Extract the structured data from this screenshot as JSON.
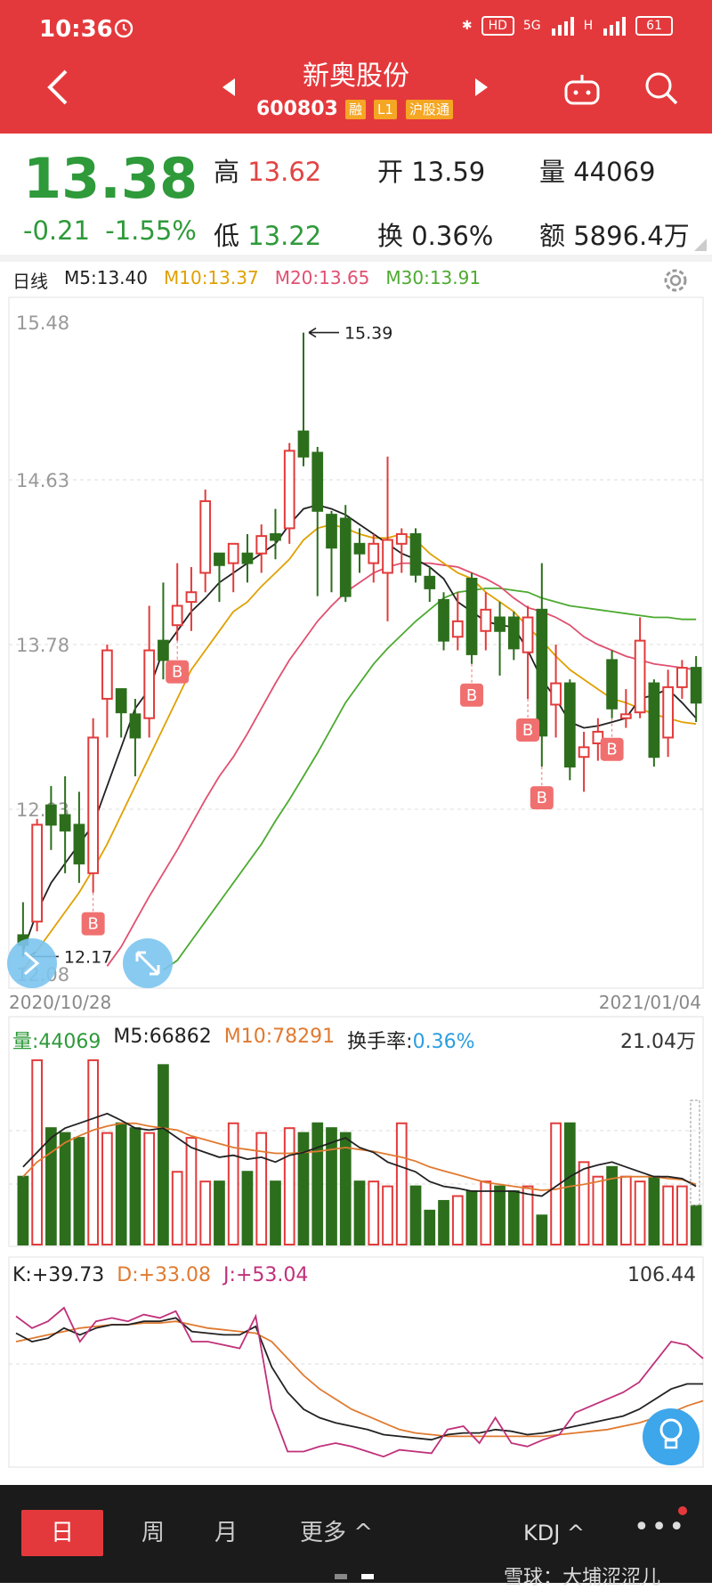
{
  "status": {
    "time": "10:36",
    "battery": "61",
    "hd": "HD",
    "net": "5G",
    "h": "H"
  },
  "header": {
    "name": "新奥股份",
    "code": "600803",
    "tags": [
      "融",
      "L1",
      "沪股通"
    ]
  },
  "quote": {
    "price": "13.38",
    "change": "-0.21",
    "change_pct": "-1.55%",
    "high_label": "高",
    "high": "13.62",
    "low_label": "低",
    "low": "13.22",
    "open_label": "开",
    "open": "13.59",
    "turn_label": "换",
    "turn": "0.36%",
    "vol_label": "量",
    "vol": "44069",
    "amt_label": "额",
    "amt": "5896.4万"
  },
  "chart": {
    "period": "日线",
    "ma": [
      {
        "label": "M5:13.40",
        "color": "#222222"
      },
      {
        "label": "M10:13.37",
        "color": "#e0a000"
      },
      {
        "label": "M20:13.65",
        "color": "#e05070"
      },
      {
        "label": "M30:13.91",
        "color": "#4caa30"
      }
    ],
    "y_ticks": [
      "15.48",
      "14.63",
      "13.78",
      "12.93",
      "12.08"
    ],
    "high_marker": "15.39",
    "low_marker": "12.17",
    "signal_label": "B",
    "start_date": "2020/10/28",
    "end_date": "2021/01/04"
  },
  "volume": {
    "items": [
      {
        "label": "量:44069",
        "color": "#2e9a3a"
      },
      {
        "label": "M5:66862",
        "color": "#222222"
      },
      {
        "label": "M10:78291",
        "color": "#e07a30"
      },
      {
        "label": "换手率:",
        "color": "#222222"
      },
      {
        "label": "0.36%",
        "color": "#2a9ee0"
      }
    ],
    "max": "21.04万"
  },
  "kdj": {
    "items": [
      {
        "label": "K:+39.73",
        "color": "#222222"
      },
      {
        "label": "D:+33.08",
        "color": "#e07a30"
      },
      {
        "label": "J:+53.04",
        "color": "#c0307a"
      }
    ],
    "max": "106.44"
  },
  "bottom": {
    "tabs": [
      "日",
      "周",
      "月",
      "更多 ^"
    ],
    "indicator": "KDJ ^",
    "more": "•••",
    "watermark": "雪球：大埔涩涩儿"
  },
  "chart_data": {
    "type": "candlestick",
    "x_start": "2020/10/28",
    "x_end": "2021/01/04",
    "ylim": [
      12.08,
      15.48
    ],
    "candles": [
      {
        "o": 12.28,
        "c": 12.23,
        "h": 12.45,
        "l": 12.17
      },
      {
        "o": 12.35,
        "c": 12.85,
        "h": 12.88,
        "l": 12.3
      },
      {
        "o": 12.95,
        "c": 12.85,
        "h": 13.05,
        "l": 12.72
      },
      {
        "o": 12.9,
        "c": 12.82,
        "h": 13.1,
        "l": 12.6
      },
      {
        "o": 12.85,
        "c": 12.65,
        "h": 13.02,
        "l": 12.55
      },
      {
        "o": 12.6,
        "c": 13.3,
        "h": 13.4,
        "l": 12.5
      },
      {
        "o": 13.5,
        "c": 13.75,
        "h": 13.78,
        "l": 13.3
      },
      {
        "o": 13.55,
        "c": 13.43,
        "h": 13.55,
        "l": 13.3
      },
      {
        "o": 13.42,
        "c": 13.3,
        "h": 13.5,
        "l": 13.1
      },
      {
        "o": 13.4,
        "c": 13.75,
        "h": 13.98,
        "l": 13.3
      },
      {
        "o": 13.8,
        "c": 13.7,
        "h": 14.1,
        "l": 13.6
      },
      {
        "o": 13.88,
        "c": 13.98,
        "h": 14.2,
        "l": 13.8
      },
      {
        "o": 14.0,
        "c": 14.05,
        "h": 14.18,
        "l": 13.85
      },
      {
        "o": 14.15,
        "c": 14.52,
        "h": 14.58,
        "l": 14.05
      },
      {
        "o": 14.25,
        "c": 14.19,
        "h": 14.25,
        "l": 14.0
      },
      {
        "o": 14.2,
        "c": 14.3,
        "h": 14.3,
        "l": 14.05
      },
      {
        "o": 14.25,
        "c": 14.2,
        "h": 14.35,
        "l": 14.1
      },
      {
        "o": 14.25,
        "c": 14.34,
        "h": 14.4,
        "l": 14.15
      },
      {
        "o": 14.35,
        "c": 14.32,
        "h": 14.48,
        "l": 14.22
      },
      {
        "o": 14.38,
        "c": 14.78,
        "h": 14.82,
        "l": 14.3
      },
      {
        "o": 14.88,
        "c": 14.75,
        "h": 15.39,
        "l": 14.7
      },
      {
        "o": 14.77,
        "c": 14.47,
        "h": 14.8,
        "l": 14.03
      },
      {
        "o": 14.45,
        "c": 14.28,
        "h": 14.47,
        "l": 14.05
      },
      {
        "o": 14.43,
        "c": 14.03,
        "h": 14.5,
        "l": 14.0
      },
      {
        "o": 14.3,
        "c": 14.25,
        "h": 14.38,
        "l": 14.15
      },
      {
        "o": 14.2,
        "c": 14.3,
        "h": 14.35,
        "l": 14.1
      },
      {
        "o": 14.15,
        "c": 14.32,
        "h": 14.75,
        "l": 13.9
      },
      {
        "o": 14.3,
        "c": 14.35,
        "h": 14.38,
        "l": 14.15
      },
      {
        "o": 14.35,
        "c": 14.14,
        "h": 14.38,
        "l": 14.1
      },
      {
        "o": 14.13,
        "c": 14.07,
        "h": 14.18,
        "l": 14.0
      },
      {
        "o": 14.01,
        "c": 13.8,
        "h": 14.05,
        "l": 13.75
      },
      {
        "o": 13.82,
        "c": 13.9,
        "h": 14.05,
        "l": 13.75
      },
      {
        "o": 14.12,
        "c": 13.73,
        "h": 14.15,
        "l": 13.68
      },
      {
        "o": 13.85,
        "c": 13.96,
        "h": 14.05,
        "l": 13.75
      },
      {
        "o": 13.92,
        "c": 13.85,
        "h": 14.0,
        "l": 13.62
      },
      {
        "o": 13.92,
        "c": 13.76,
        "h": 13.95,
        "l": 13.7
      },
      {
        "o": 13.74,
        "c": 13.92,
        "h": 13.98,
        "l": 13.5
      },
      {
        "o": 13.96,
        "c": 13.31,
        "h": 14.2,
        "l": 13.15
      },
      {
        "o": 13.47,
        "c": 13.58,
        "h": 13.78,
        "l": 13.3
      },
      {
        "o": 13.58,
        "c": 13.15,
        "h": 13.6,
        "l": 13.08
      },
      {
        "o": 13.2,
        "c": 13.25,
        "h": 13.33,
        "l": 13.02
      },
      {
        "o": 13.27,
        "c": 13.33,
        "h": 13.4,
        "l": 13.18
      },
      {
        "o": 13.7,
        "c": 13.45,
        "h": 13.75,
        "l": 13.4
      },
      {
        "o": 13.4,
        "c": 13.42,
        "h": 13.55,
        "l": 13.35
      },
      {
        "o": 13.43,
        "c": 13.8,
        "h": 13.92,
        "l": 13.4
      },
      {
        "o": 13.58,
        "c": 13.2,
        "h": 13.6,
        "l": 13.15
      },
      {
        "o": 13.3,
        "c": 13.56,
        "h": 13.65,
        "l": 13.2
      },
      {
        "o": 13.56,
        "c": 13.66,
        "h": 13.7,
        "l": 13.5
      },
      {
        "o": 13.66,
        "c": 13.48,
        "h": 13.72,
        "l": 13.38
      }
    ],
    "buy_signals": [
      5,
      11,
      32,
      36,
      37,
      42
    ],
    "ma5": [
      12.2,
      12.4,
      12.55,
      12.65,
      12.75,
      12.85,
      13.05,
      13.25,
      13.45,
      13.55,
      13.75,
      13.85,
      13.95,
      14.02,
      14.1,
      14.15,
      14.2,
      14.25,
      14.3,
      14.4,
      14.48,
      14.5,
      14.48,
      14.45,
      14.4,
      14.35,
      14.3,
      14.25,
      14.22,
      14.18,
      14.12,
      14.0,
      13.95,
      13.9,
      13.88,
      13.87,
      13.75,
      13.6,
      13.5,
      13.38,
      13.35,
      13.36,
      13.38,
      13.4,
      13.5,
      13.52,
      13.55,
      13.48,
      13.4
    ],
    "ma10": [
      12.1,
      12.2,
      12.3,
      12.4,
      12.5,
      12.62,
      12.75,
      12.9,
      13.05,
      13.2,
      13.35,
      13.5,
      13.65,
      13.75,
      13.85,
      13.95,
      14.0,
      14.08,
      14.15,
      14.22,
      14.32,
      14.38,
      14.4,
      14.38,
      14.35,
      14.33,
      14.33,
      14.35,
      14.32,
      14.25,
      14.2,
      14.15,
      14.12,
      14.05,
      14.0,
      13.95,
      13.87,
      13.8,
      13.72,
      13.65,
      13.6,
      13.55,
      13.5,
      13.48,
      13.45,
      13.42,
      13.4,
      13.38,
      13.37
    ],
    "ma20": [
      null,
      null,
      null,
      null,
      null,
      null,
      12.12,
      12.22,
      12.35,
      12.48,
      12.6,
      12.72,
      12.85,
      12.98,
      13.1,
      13.2,
      13.32,
      13.45,
      13.58,
      13.7,
      13.8,
      13.9,
      13.98,
      14.05,
      14.1,
      14.15,
      14.18,
      14.2,
      14.2,
      14.2,
      14.19,
      14.18,
      14.15,
      14.12,
      14.08,
      14.02,
      13.97,
      13.95,
      13.92,
      13.88,
      13.82,
      13.78,
      13.75,
      13.72,
      13.7,
      13.68,
      13.67,
      13.66,
      13.65
    ],
    "ma30": [
      null,
      null,
      null,
      null,
      null,
      null,
      null,
      null,
      null,
      null,
      12.1,
      12.15,
      12.25,
      12.35,
      12.45,
      12.55,
      12.65,
      12.75,
      12.87,
      12.98,
      13.1,
      13.22,
      13.35,
      13.48,
      13.58,
      13.68,
      13.76,
      13.83,
      13.9,
      13.96,
      14.02,
      14.05,
      14.06,
      14.07,
      14.07,
      14.06,
      14.05,
      14.02,
      14.0,
      13.98,
      13.97,
      13.96,
      13.95,
      13.94,
      13.93,
      13.92,
      13.92,
      13.91,
      13.91
    ],
    "volume": [
      70,
      190,
      120,
      115,
      110,
      190,
      115,
      125,
      120,
      115,
      185,
      75,
      110,
      65,
      65,
      125,
      75,
      115,
      65,
      120,
      115,
      125,
      120,
      115,
      65,
      65,
      60,
      125,
      60,
      35,
      45,
      50,
      55,
      65,
      60,
      55,
      60,
      30,
      125,
      125,
      85,
      70,
      80,
      70,
      65,
      70,
      60,
      60,
      40
    ],
    "volume_ma5": [
      80,
      95,
      110,
      120,
      125,
      130,
      135,
      128,
      120,
      118,
      120,
      110,
      100,
      95,
      90,
      92,
      88,
      90,
      85,
      92,
      95,
      100,
      105,
      110,
      100,
      95,
      85,
      80,
      75,
      65,
      60,
      58,
      55,
      55,
      55,
      55,
      52,
      50,
      60,
      70,
      78,
      82,
      85,
      80,
      75,
      70,
      70,
      68,
      60
    ],
    "volume_ma10": [
      70,
      85,
      95,
      105,
      112,
      118,
      122,
      125,
      125,
      122,
      120,
      118,
      112,
      108,
      104,
      100,
      98,
      96,
      94,
      94,
      95,
      96,
      98,
      100,
      98,
      96,
      93,
      90,
      86,
      80,
      76,
      72,
      68,
      64,
      62,
      60,
      58,
      56,
      57,
      60,
      62,
      65,
      68,
      70,
      70,
      70,
      68,
      67,
      62
    ],
    "k": [
      75,
      70,
      72,
      78,
      74,
      78,
      80,
      80,
      82,
      82,
      84,
      76,
      75,
      74,
      74,
      79,
      55,
      40,
      30,
      25,
      22,
      20,
      18,
      15,
      14,
      13,
      12,
      15,
      16,
      16,
      18,
      17,
      15,
      16,
      18,
      20,
      22,
      24,
      26,
      30,
      36,
      42,
      45,
      45
    ],
    "d": [
      70,
      72,
      74,
      76,
      78,
      79,
      80,
      80,
      81,
      81,
      82,
      80,
      78,
      77,
      76,
      75,
      70,
      60,
      50,
      42,
      36,
      30,
      26,
      22,
      18,
      16,
      15,
      14,
      14,
      14,
      14,
      14,
      14,
      14,
      15,
      16,
      17,
      18,
      20,
      22,
      25,
      28,
      32,
      35
    ],
    "j": [
      85,
      78,
      82,
      90,
      70,
      82,
      84,
      82,
      86,
      84,
      88,
      70,
      70,
      68,
      66,
      85,
      30,
      5,
      5,
      8,
      10,
      8,
      5,
      2,
      6,
      5,
      4,
      18,
      20,
      10,
      25,
      10,
      8,
      12,
      15,
      28,
      32,
      36,
      40,
      46,
      58,
      70,
      68,
      60
    ]
  }
}
